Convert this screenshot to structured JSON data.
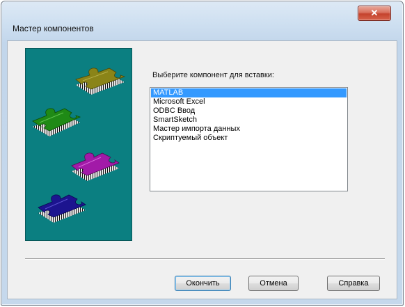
{
  "window": {
    "title": "Мастер компонентов",
    "close_glyph": "✕"
  },
  "dialog": {
    "prompt": "Выберите компонент для вставки:",
    "components": [
      {
        "label": "MATLAB",
        "selected": true
      },
      {
        "label": "Microsoft Excel",
        "selected": false
      },
      {
        "label": "ODBC Ввод",
        "selected": false
      },
      {
        "label": "SmartSketch",
        "selected": false
      },
      {
        "label": "Мастер импорта данных",
        "selected": false
      },
      {
        "label": "Скриптуемый объект",
        "selected": false
      }
    ],
    "art": {
      "background_color": "#0b7f81",
      "pieces": [
        {
          "name": "olive-puzzle-piece-icon",
          "color": "#8a8418"
        },
        {
          "name": "green-puzzle-piece-icon",
          "color": "#1f8a16"
        },
        {
          "name": "magenta-puzzle-piece-icon",
          "color": "#a21aa8"
        },
        {
          "name": "blue-puzzle-piece-icon",
          "color": "#1c148f"
        }
      ]
    }
  },
  "buttons": {
    "finish": "Окончить",
    "cancel": "Отмена",
    "help": "Справка"
  },
  "colors": {
    "selection": "#3399ff",
    "close_button": "#c4432d"
  }
}
